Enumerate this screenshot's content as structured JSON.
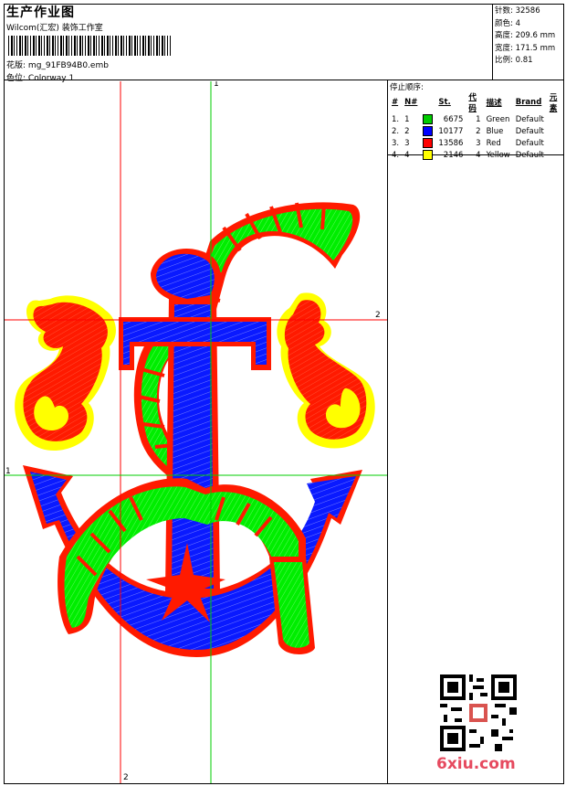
{
  "header": {
    "title": "生产作业图",
    "studio": "Wilcom(汇宏) 装饰工作室",
    "pattern_label": "花版:",
    "pattern_file": "mg_91FB94B0.emb",
    "colorway_label": "色位:",
    "colorway_value": "Colorway 1"
  },
  "specs": [
    {
      "label": "针数:",
      "value": "32586"
    },
    {
      "label": "颜色:",
      "value": "4"
    },
    {
      "label": "高度:",
      "value": "209.6 mm"
    },
    {
      "label": "宽度:",
      "value": "171.5 mm"
    },
    {
      "label": "比例:",
      "value": "0.81"
    }
  ],
  "stop_sequence": {
    "heading": "停止顺序:",
    "columns": [
      "#",
      "N#",
      "St.",
      "代码",
      "描述",
      "Brand",
      "元素"
    ],
    "rows": [
      {
        "idx": "1.",
        "n": "1",
        "color": "#00cc00",
        "st": "6675",
        "code": "1",
        "desc": "Green",
        "brand": "Default"
      },
      {
        "idx": "2.",
        "n": "2",
        "color": "#0000ff",
        "st": "10177",
        "code": "2",
        "desc": "Blue",
        "brand": "Default"
      },
      {
        "idx": "3.",
        "n": "3",
        "color": "#ff0000",
        "st": "13586",
        "code": "3",
        "desc": "Red",
        "brand": "Default"
      },
      {
        "idx": "4.",
        "n": "4",
        "color": "#ffff00",
        "st": "2146",
        "code": "4",
        "desc": "Yellow",
        "brand": "Default"
      }
    ]
  },
  "guides": {
    "top_label": "1",
    "bottom_label": "2",
    "left_label": "1",
    "right_label": "2"
  },
  "watermark": {
    "logo": "6xiu.com"
  },
  "colors": {
    "green": "#00ee00",
    "blue": "#0a1aff",
    "red": "#ff1a00",
    "yellow": "#ffff00",
    "guide_red": "#ff0000",
    "guide_green": "#00cc00"
  }
}
